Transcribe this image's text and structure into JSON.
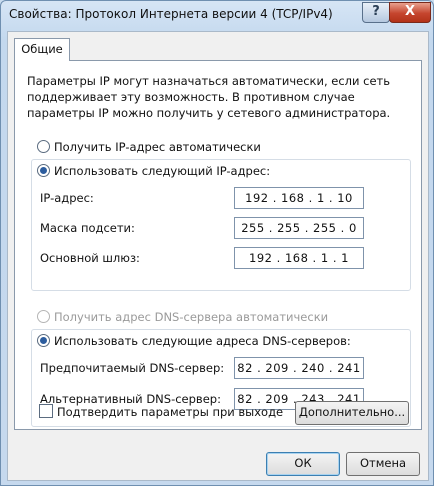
{
  "window": {
    "title": "Свойства: Протокол Интернета версии 4 (TCP/IPv4)",
    "help_glyph": "?",
    "close_glyph": "X"
  },
  "tabs": [
    "Общие"
  ],
  "intro": "Параметры IP могут назначаться автоматически, если сеть поддерживает эту возможность. В противном случае параметры IP можно получить у сетевого администратора.",
  "ip": {
    "auto_label": "Получить IP-адрес автоматически",
    "manual_label": "Использовать следующий IP-адрес:",
    "selected": "manual",
    "fields": [
      {
        "label": "IP-адрес:",
        "value": "192 . 168 .  1  . 10"
      },
      {
        "label": "Маска подсети:",
        "value": "255 . 255 . 255 .  0"
      },
      {
        "label": "Основной шлюз:",
        "value": "192 . 168 .  1  .  1"
      }
    ]
  },
  "dns": {
    "auto_label": "Получить адрес DNS-сервера автоматически",
    "manual_label": "Использовать следующие адреса DNS-серверов:",
    "selected": "manual",
    "fields": [
      {
        "label": "Предпочитаемый DNS-сервер:",
        "value": "82 . 209 . 240 . 241"
      },
      {
        "label": "Альтернативный DNS-сервер:",
        "value": "82 . 209 . 243 . 241"
      }
    ]
  },
  "validate_label": "Подтвердить параметры при выходе",
  "validate_checked": false,
  "advanced_button": "Дополнительно...",
  "ok_button": "ОК",
  "cancel_button": "Отмена",
  "colors": {
    "accent": "#2d5d9e",
    "titlebar": "#c3d8ee",
    "close": "#c5452e"
  }
}
